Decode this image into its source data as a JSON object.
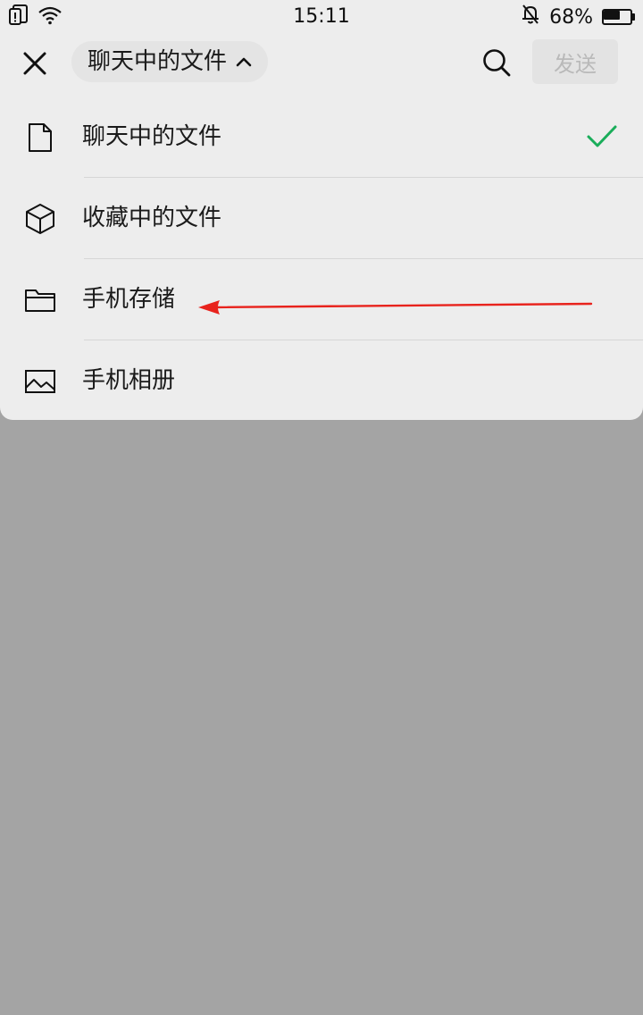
{
  "status_bar": {
    "time": "15:11",
    "battery_percent": "68%",
    "battery_level": 0.68,
    "icons": [
      "notification-alert-icon",
      "wifi-icon",
      "bell-muted-icon",
      "battery-icon"
    ]
  },
  "toolbar": {
    "selector_label": "聊天中的文件",
    "send_label": "发送",
    "icons": [
      "close-icon",
      "chevron-up-icon",
      "search-icon"
    ]
  },
  "menu": {
    "items": [
      {
        "label": "聊天中的文件",
        "icon": "file-icon",
        "selected": true
      },
      {
        "label": "收藏中的文件",
        "icon": "cube-icon",
        "selected": false
      },
      {
        "label": "手机存储",
        "icon": "folder-icon",
        "selected": false
      },
      {
        "label": "手机相册",
        "icon": "image-icon",
        "selected": false
      }
    ]
  },
  "colors": {
    "panel_background": "#ededed",
    "overlay_background": "#a4a4a4",
    "check_color": "#1aad5a",
    "annotation_arrow": "#e8231d",
    "send_disabled_text": "#b9b9b9"
  }
}
